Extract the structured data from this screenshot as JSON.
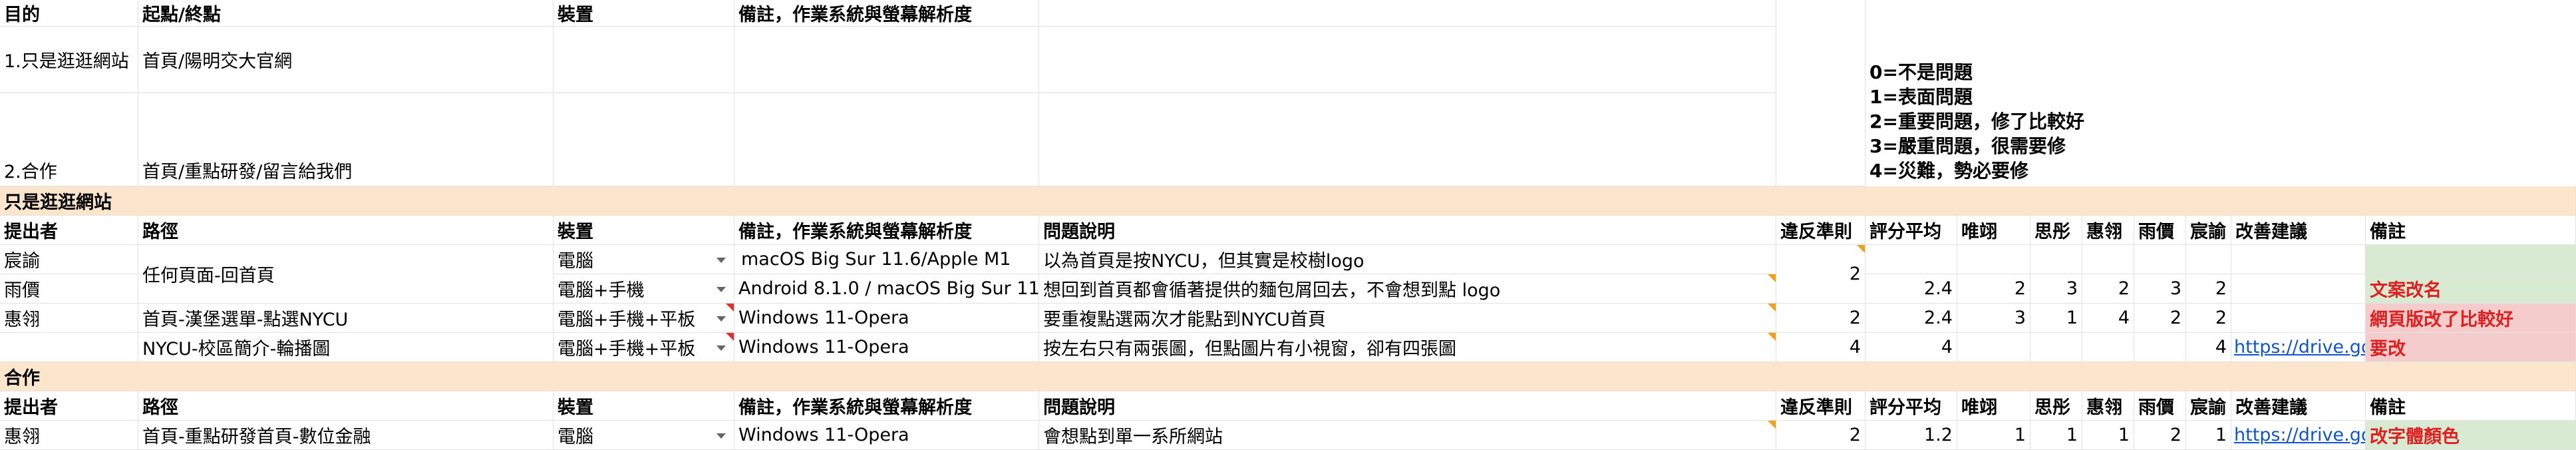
{
  "top": {
    "h_purpose": "目的",
    "h_route": "起點/終點",
    "h_device": "裝置",
    "h_notes": "備註，作業系統與螢幕解析度",
    "purpose1": "1.只是逛逛網站",
    "route1": "首頁/陽明交大官網",
    "purpose2": "2.合作",
    "route2": "首頁/重點研發/留言給我們"
  },
  "legend": [
    "0=不是問題",
    "1=表面問題",
    "2=重要問題，修了比較好",
    "3=嚴重問題，很需要修",
    "4=災難，勢必要修"
  ],
  "section1": "只是逛逛網站",
  "section2": "合作",
  "headers": {
    "reporter": "提出者",
    "path": "路徑",
    "device": "裝置",
    "notes": "備註，作業系統與螢幕解析度",
    "problem": "問題說明",
    "rule": "違反準則",
    "avg": "評分平均",
    "r1": "唯翊",
    "r2": "思彤",
    "r3": "惠翎",
    "r4": "雨價",
    "r5": "宸諭",
    "suggest": "改善建議",
    "remark": "備註"
  },
  "rows": [
    {
      "reporter": "宸諭",
      "device": "電腦",
      "notes": "macOS Big Sur 11.6/Apple M1",
      "problem": "以為首頁是按NYCU，但其實是校樹logo"
    },
    {
      "reporter": "雨價",
      "device": "電腦+手機",
      "notes": "Android 8.1.0 / macOS Big Sur 11.4",
      "problem": "想回到首頁都會循著提供的麵包屑回去，不會想到點 logo",
      "avg": "2.4",
      "r1": "2",
      "r2": "3",
      "r3": "2",
      "r4": "3",
      "r5": "2",
      "remark": "文案改名"
    },
    {
      "reporter": "惠翎",
      "path": "首頁-漢堡選單-點選NYCU",
      "device": "電腦+手機+平板",
      "notes": "Windows 11-Opera",
      "problem": "要重複點選兩次才能點到NYCU首頁",
      "rule": "2",
      "avg": "2.4",
      "r1": "2",
      "r2": "3",
      "r3": "1",
      "r4": "4",
      "r5": "2",
      "r6": "2",
      "remark": "網頁版改了比較好"
    },
    {
      "reporter": "",
      "path": "NYCU-校區簡介-輪播圖",
      "device": "電腦+手機+平板",
      "notes": "Windows 11-Opera",
      "problem": "按左右只有兩張圖，但點圖片有小視窗，卻有四張圖",
      "rule": "4",
      "avg": "4",
      "r5": "4",
      "suggest": "https://drive.goo",
      "remark": "要改"
    },
    {
      "reporter": "惠翎",
      "path": "首頁-重點研發首頁-數位金融",
      "device": "電腦",
      "notes": "Windows 11-Opera",
      "problem": "會想點到單一系所網站",
      "rule": "2",
      "avg": "1.2",
      "r1": "1",
      "r2": "1",
      "r3": "1",
      "r4": "2",
      "r5": "1",
      "suggest": "https://drive.goo",
      "remark": "改字體顏色"
    }
  ],
  "merged_path": "任何頁面-回首頁",
  "merged_rule": "2"
}
